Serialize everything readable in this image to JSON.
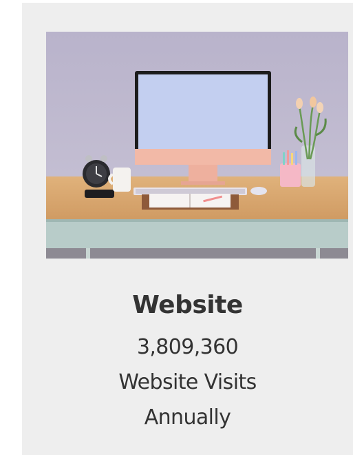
{
  "card": {
    "image": {
      "subject": "desk-workspace-photo"
    },
    "title": "Website",
    "stat_value": "3,809,360",
    "stat_label": "Website Visits",
    "stat_period": "Annually"
  },
  "colors": {
    "card_background": "#eeeeee",
    "text": "#333333",
    "wall": "#b7b3c9",
    "desk": "#d9a46c",
    "desk_front": "#b6ccc8",
    "monitor_stand": "#f2b7a6"
  }
}
